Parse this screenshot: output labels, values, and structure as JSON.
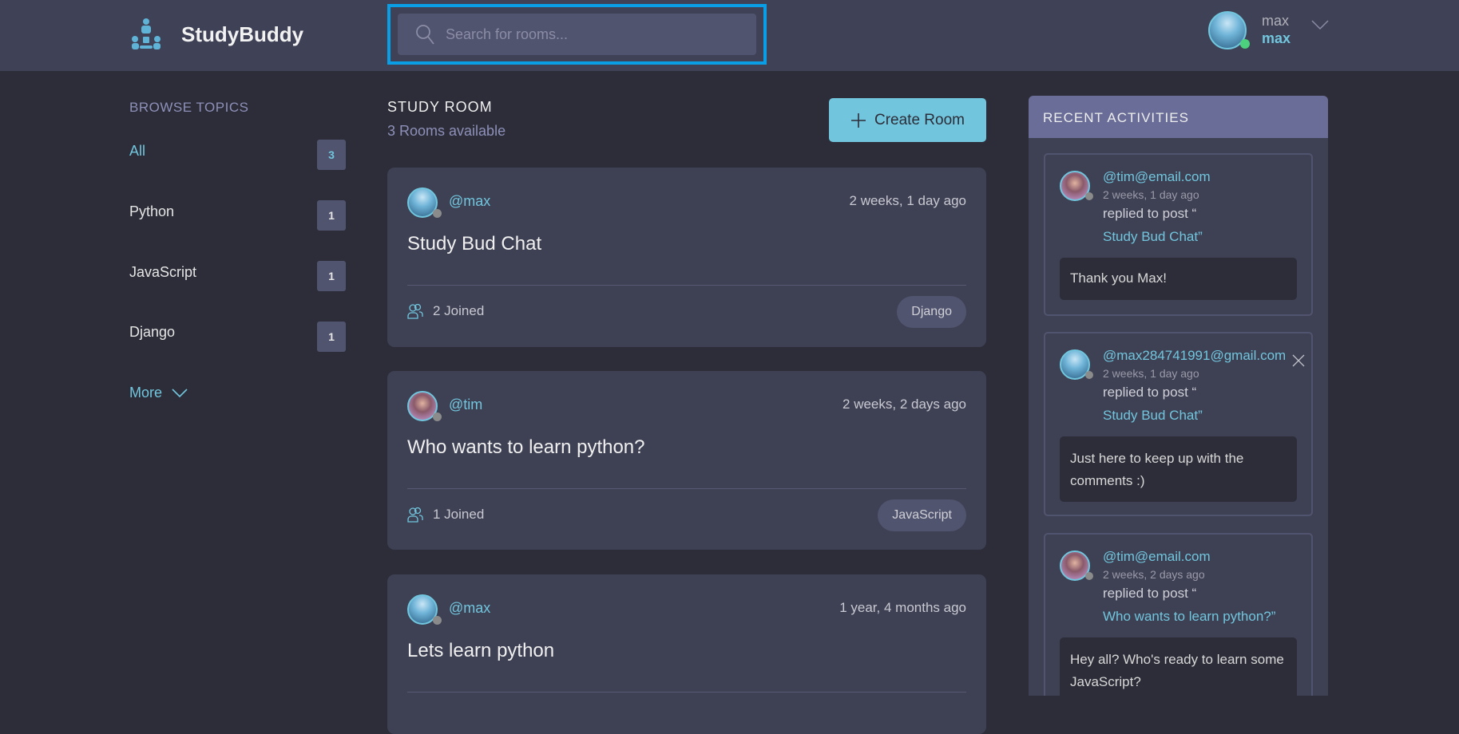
{
  "header": {
    "brand": "StudyBuddy",
    "search_placeholder": "Search for rooms...",
    "user": {
      "name": "max",
      "handle": "max"
    }
  },
  "sidebar": {
    "title": "BROWSE TOPICS",
    "topics": [
      {
        "label": "All",
        "count": "3"
      },
      {
        "label": "Python",
        "count": "1"
      },
      {
        "label": "JavaScript",
        "count": "1"
      },
      {
        "label": "Django",
        "count": "1"
      }
    ],
    "more": "More"
  },
  "main": {
    "title": "STUDY ROOM",
    "subtitle": "3 Rooms available",
    "create": "Create Room",
    "rooms": [
      {
        "host": "@max",
        "time": "2 weeks, 1 day ago",
        "title": "Study Bud Chat",
        "joined": "2 Joined",
        "topic": "Django"
      },
      {
        "host": "@tim",
        "time": "2 weeks, 2 days ago",
        "title": "Who wants to learn python?",
        "joined": "1 Joined",
        "topic": "JavaScript"
      },
      {
        "host": "@max",
        "time": "1 year, 4 months ago",
        "title": "Lets learn python"
      }
    ]
  },
  "activity": {
    "title": "RECENT ACTIVITIES",
    "items": [
      {
        "user": "@tim@email.com",
        "time": "2 weeks, 1 day ago",
        "action": "replied to post “",
        "post": "Study Bud Chat”",
        "body": "Thank you Max!"
      },
      {
        "user": "@max284741991@gmail.com",
        "time": "2 weeks, 1 day ago",
        "action": "replied to post “",
        "post": "Study Bud Chat”",
        "body": "Just here to keep up with the comments :)"
      },
      {
        "user": "@tim@email.com",
        "time": "2 weeks, 2 days ago",
        "action": "replied to post “",
        "post": "Who wants to learn python?”",
        "body": "Hey all? Who's ready to learn some JavaScript?"
      }
    ]
  },
  "colors": {
    "accent": "#71c6dd",
    "background": "#2d2d39",
    "card": "#3e4054",
    "panel_header": "#696d97",
    "online": "#4cd07d"
  }
}
